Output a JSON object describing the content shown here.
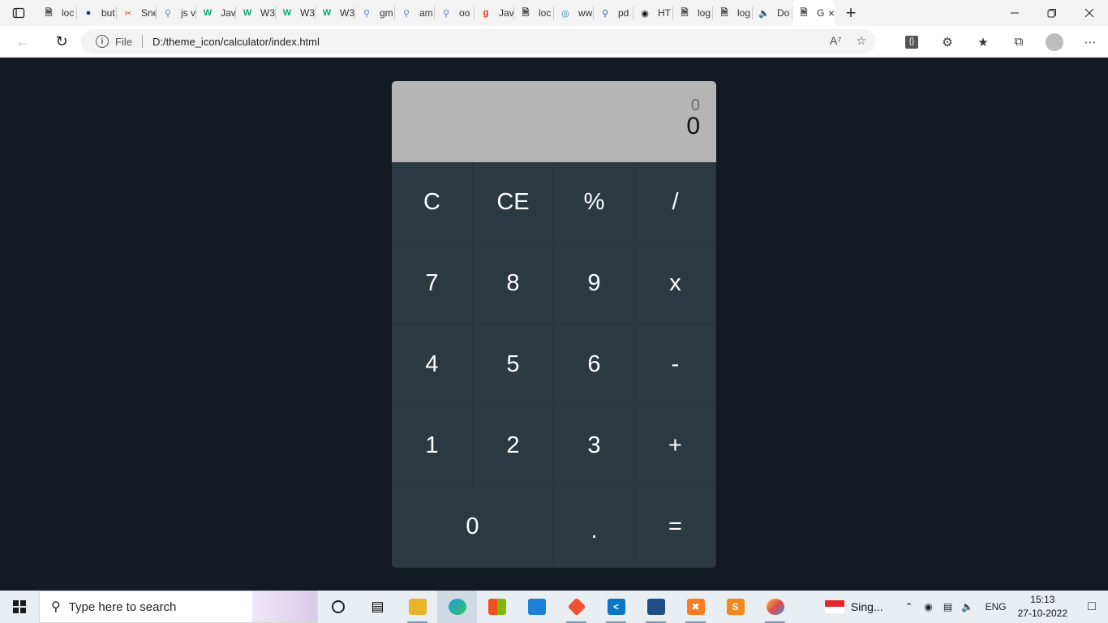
{
  "browser": {
    "tabs": [
      {
        "icon": "page-icon",
        "title": "loc",
        "icon_color": "#444444"
      },
      {
        "icon": "profile-icon",
        "title": "but",
        "icon_color": "#1b3a6b"
      },
      {
        "icon": "snip-icon",
        "title": "Sne",
        "icon_color": "#d94c3a"
      },
      {
        "icon": "search-icon",
        "title": "js v",
        "icon_color": "#5b7fb8"
      },
      {
        "icon": "w3schools-icon",
        "title": "Jav",
        "icon_color": "#04aa6d"
      },
      {
        "icon": "w3schools-icon",
        "title": "W3",
        "icon_color": "#04aa6d"
      },
      {
        "icon": "w3schools-icon",
        "title": "W3",
        "icon_color": "#04aa6d"
      },
      {
        "icon": "w3schools-icon",
        "title": "W3",
        "icon_color": "#04aa6d"
      },
      {
        "icon": "search-icon",
        "title": "gm",
        "icon_color": "#5b7fb8"
      },
      {
        "icon": "search-icon",
        "title": "am",
        "icon_color": "#5b7fb8"
      },
      {
        "icon": "search-icon",
        "title": "oo",
        "icon_color": "#5b7fb8"
      },
      {
        "icon": "g-icon",
        "title": "Jav",
        "icon_color": "#d93025"
      },
      {
        "icon": "page-icon",
        "title": "loc",
        "icon_color": "#444444"
      },
      {
        "icon": "globe-icon",
        "title": "ww",
        "icon_color": "#2a86a8"
      },
      {
        "icon": "search-icon",
        "title": "pd",
        "icon_color": "#2b5fb8"
      },
      {
        "icon": "github-icon",
        "title": "HT",
        "icon_color": "#111111"
      },
      {
        "icon": "page-icon",
        "title": "log",
        "icon_color": "#444444"
      },
      {
        "icon": "page-icon",
        "title": "log",
        "icon_color": "#444444"
      },
      {
        "icon": "speaker-icon",
        "title": "Do",
        "icon_color": "#444444"
      },
      {
        "icon": "page-icon",
        "title": "Ga",
        "icon_color": "#444444"
      }
    ],
    "active_tab_close": "×",
    "new_tab": "+",
    "address": {
      "scheme": "File",
      "url": "D:/theme_icon/calculator/index.html"
    }
  },
  "calculator": {
    "previous_operand": "0",
    "current_operand": "0",
    "keys": [
      {
        "label": "C",
        "name": "clear-button"
      },
      {
        "label": "CE",
        "name": "clear-entry-button"
      },
      {
        "label": "%",
        "name": "percent-button"
      },
      {
        "label": "/",
        "name": "divide-button"
      },
      {
        "label": "7",
        "name": "digit-7-button"
      },
      {
        "label": "8",
        "name": "digit-8-button"
      },
      {
        "label": "9",
        "name": "digit-9-button"
      },
      {
        "label": "x",
        "name": "multiply-button"
      },
      {
        "label": "4",
        "name": "digit-4-button"
      },
      {
        "label": "5",
        "name": "digit-5-button"
      },
      {
        "label": "6",
        "name": "digit-6-button"
      },
      {
        "label": "-",
        "name": "subtract-button"
      },
      {
        "label": "1",
        "name": "digit-1-button"
      },
      {
        "label": "2",
        "name": "digit-2-button"
      },
      {
        "label": "3",
        "name": "digit-3-button"
      },
      {
        "label": "+",
        "name": "add-button"
      },
      {
        "label": "0",
        "name": "digit-0-button"
      },
      {
        "label": ".",
        "name": "decimal-button"
      },
      {
        "label": "=",
        "name": "equals-button"
      }
    ]
  },
  "taskbar": {
    "search_placeholder": "Type here to search",
    "weather_text": "Sing...",
    "language": "ENG",
    "time": "15:13",
    "date": "27-10-2022"
  }
}
